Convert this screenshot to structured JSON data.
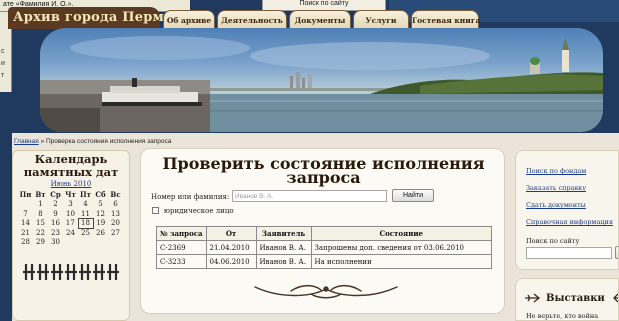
{
  "background_windows": {
    "left_title": "ате «Фамилия И. О.».",
    "left_side_lines": [
      "с",
      "и",
      "т"
    ],
    "search_title": "Поиск по сайту"
  },
  "header": {
    "site_title": "Архив города Перми",
    "nav": [
      {
        "label": "Об архиве"
      },
      {
        "label": "Деятельность"
      },
      {
        "label": "Документы"
      },
      {
        "label": "Услуги"
      },
      {
        "label": "Гостевая книга"
      }
    ]
  },
  "breadcrumb": {
    "home": "Главная",
    "separator": "»",
    "current": "Проверка состояния исполнения запроса"
  },
  "calendar": {
    "title": "Календарь памятных дат",
    "month": "Июнь 2010",
    "weekdays": [
      "Пн",
      "Вт",
      "Ср",
      "Чт",
      "Пт",
      "Сб",
      "Вс"
    ],
    "weeks": [
      [
        "",
        "1",
        "2",
        "3",
        "4",
        "5",
        "6"
      ],
      [
        "7",
        "8",
        "9",
        "10",
        "11",
        "12",
        "13"
      ],
      [
        "14",
        "15",
        "16",
        "17",
        "18",
        "19",
        "20"
      ],
      [
        "21",
        "22",
        "23",
        "24",
        "25",
        "26",
        "27"
      ],
      [
        "28",
        "29",
        "30",
        "",
        "",
        "",
        ""
      ]
    ],
    "today": "18"
  },
  "main": {
    "title": "Проверить состояние исполнения запроса",
    "search_label": "Номер или фамилия:",
    "search_placeholder": "Иванов В. А.",
    "find_button": "Найти",
    "legal_label": "юридическое лицо",
    "table": {
      "headers": [
        "№ запроса",
        "От",
        "Заявитель",
        "Состояние"
      ],
      "rows": [
        [
          "С-2369",
          "21.04.2010",
          "Иванов В. А.",
          "Запрошены доп. сведения от 03.06.2010"
        ],
        [
          "С-3233",
          "04.06.2010",
          "Иванов В. А.",
          "На исполнении"
        ]
      ]
    }
  },
  "sidebar": {
    "links": [
      "Поиск по фондам",
      "Заказать справку",
      "Сдать документы",
      "Справочная информация"
    ],
    "search_label": "Поиск по сайту",
    "search_button": ">",
    "exhibitions_title": "Выставки",
    "exhibitions_text": "Не верьте, кто война"
  },
  "colors": {
    "page_background": "#eae5d8",
    "title_bar": "#5b3a22",
    "link": "#1a3a8a"
  }
}
